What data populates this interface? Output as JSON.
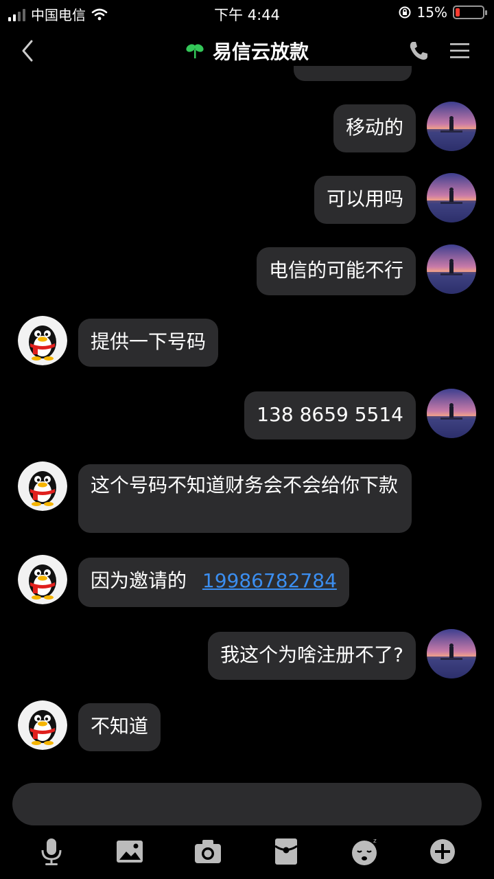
{
  "status_bar": {
    "carrier": "中国电信",
    "time": "下午 4:44",
    "battery_percent": "15%",
    "battery_level": 0.15
  },
  "header": {
    "title": "易信云放款"
  },
  "messages": [
    {
      "sender": "self",
      "text": "移动的"
    },
    {
      "sender": "self",
      "text": "可以用吗"
    },
    {
      "sender": "self",
      "text": "电信的可能不行"
    },
    {
      "sender": "other",
      "text": "提供一下号码"
    },
    {
      "sender": "self",
      "text": "138 8659 5514"
    },
    {
      "sender": "other",
      "text": "这个号码不知道财务会不会给你下款"
    },
    {
      "sender": "other",
      "text": "因为邀请的",
      "link": "19986782784"
    },
    {
      "sender": "self",
      "text": "我这个为啥注册不了?"
    },
    {
      "sender": "other",
      "text": "不知道"
    }
  ],
  "toolbar": [
    "microphone-icon",
    "image-icon",
    "camera-icon",
    "red-packet-icon",
    "emoji-icon",
    "plus-icon"
  ]
}
